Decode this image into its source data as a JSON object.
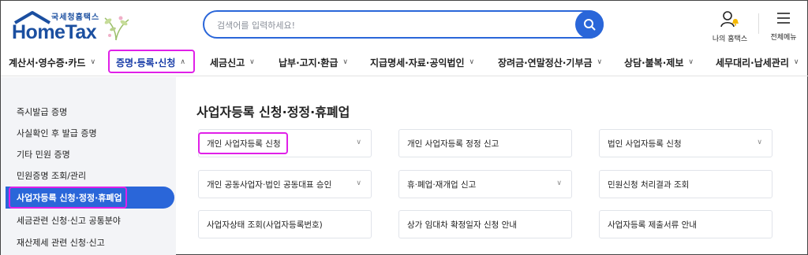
{
  "logo": {
    "subtitle": "국세청홈택스",
    "name": "HomeTax"
  },
  "search": {
    "placeholder": "검색어를 입력하세요!"
  },
  "utility": {
    "my_home": "나의 홈택스",
    "all_menu": "전체메뉴"
  },
  "nav": [
    {
      "label": "계산서·영수증·카드",
      "chevron": "∨"
    },
    {
      "label": "증명·등록·신청",
      "chevron": "∧"
    },
    {
      "label": "세금신고",
      "chevron": "∨"
    },
    {
      "label": "납부·고지·환급",
      "chevron": "∨"
    },
    {
      "label": "지급명세·자료·공익법인",
      "chevron": "∨"
    },
    {
      "label": "장려금·연말정산·기부금",
      "chevron": "∨"
    },
    {
      "label": "상담·불복·제보",
      "chevron": "∨"
    },
    {
      "label": "세무대리·납세관리",
      "chevron": "∨"
    }
  ],
  "sidebar": [
    {
      "label": "즉시발급 증명"
    },
    {
      "label": "사실확인 후 발급 증명"
    },
    {
      "label": "기타 민원 증명"
    },
    {
      "label": "민원증명 조회/관리"
    },
    {
      "label": "사업자등록 신청·정정·휴폐업"
    },
    {
      "label": "세금관련 신청·신고 공통분야"
    },
    {
      "label": "재산제세 관련 신청·신고"
    }
  ],
  "main": {
    "title": "사업자등록 신청·정정·휴폐업",
    "cards": [
      {
        "label": "개인 사업자등록 신청",
        "chevron": "∨"
      },
      {
        "label": "개인 사업자등록 정정 신고",
        "chevron": ""
      },
      {
        "label": "법인 사업자등록 신청",
        "chevron": "∨"
      },
      {
        "label": "개인 공동사업자·법인 공동대표 승인",
        "chevron": "∨"
      },
      {
        "label": "휴·폐업·재개업 신고",
        "chevron": "∨"
      },
      {
        "label": "민원신청 처리결과 조회",
        "chevron": ""
      },
      {
        "label": "사업자상태 조회(사업자등록번호)",
        "chevron": ""
      },
      {
        "label": "상가 임대차 확정일자 신청 안내",
        "chevron": ""
      },
      {
        "label": "사업자등록 제출서류 안내",
        "chevron": ""
      }
    ]
  },
  "colors": {
    "primary": "#2a66d9",
    "highlight": "#e020e8",
    "brand": "#1b4fa0"
  }
}
